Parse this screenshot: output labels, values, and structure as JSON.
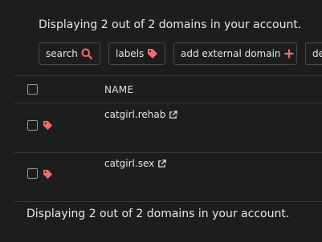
{
  "summary_top": "Displaying 2 out of 2 domains in your account.",
  "toolbar": {
    "search_label": "search",
    "labels_label": "labels",
    "add_domain_label": "add external domain",
    "more_label": "de"
  },
  "table": {
    "column_name": "NAME",
    "rows": [
      {
        "domain": "catgirl.rehab"
      },
      {
        "domain": "catgirl.sex"
      }
    ]
  },
  "summary_bottom": "Displaying 2 out of 2 domains in your account.",
  "colors": {
    "accent": "#f26b6b",
    "background": "#1d1d1d",
    "border": "#4a4a4a"
  },
  "icons": [
    "search-icon",
    "tag-icon",
    "plus-icon",
    "external-link-icon"
  ]
}
